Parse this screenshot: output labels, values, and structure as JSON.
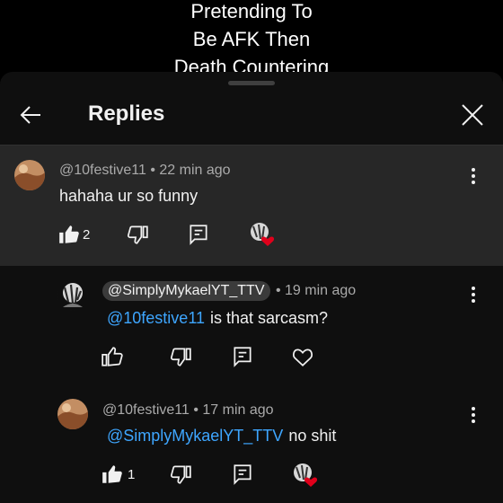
{
  "video_title": [
    "Pretending To",
    "Be AFK Then",
    "Death Countering"
  ],
  "header": {
    "title": "Replies"
  },
  "parent_comment": {
    "handle": "@10festive11",
    "time": "• 22 min ago",
    "text": "hahaha ur so funny",
    "like_count": "2",
    "hearted": true
  },
  "replies": [
    {
      "handle": "@SimplyMykaelYT_TTV",
      "is_creator": true,
      "time": "• 19 min ago",
      "mention": "@10festive11",
      "text": "is that sarcasm?",
      "like_count": ""
    },
    {
      "handle": "@10festive11",
      "is_creator": false,
      "time": "• 17 min ago",
      "mention": "@SimplyMykaelYT_TTV",
      "text": "no shit",
      "like_count": "1",
      "hearted": true
    }
  ],
  "colors": {
    "mention": "#3ea6ff",
    "heart": "#e0001b",
    "parent_bg": "#272727",
    "sheet_bg": "#0f0f0f"
  }
}
